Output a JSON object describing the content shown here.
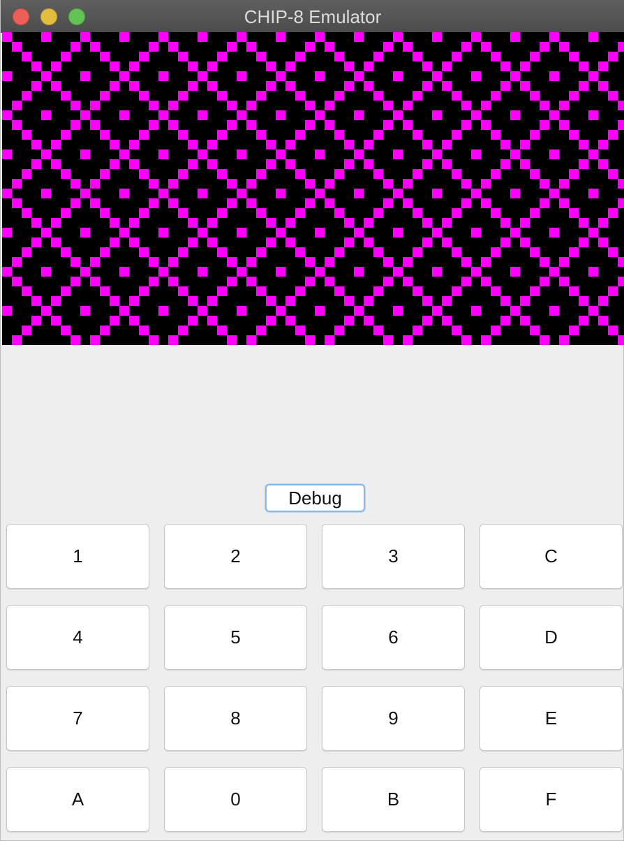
{
  "window": {
    "title": "CHIP-8 Emulator"
  },
  "display": {
    "pixel_color": "#ff00ff",
    "background_color": "#000000",
    "pattern": "diamond-lattice"
  },
  "debug_button": {
    "label": "Debug"
  },
  "keypad": {
    "rows": [
      [
        "1",
        "2",
        "3",
        "C"
      ],
      [
        "4",
        "5",
        "6",
        "D"
      ],
      [
        "7",
        "8",
        "9",
        "E"
      ],
      [
        "A",
        "0",
        "B",
        "F"
      ]
    ]
  }
}
